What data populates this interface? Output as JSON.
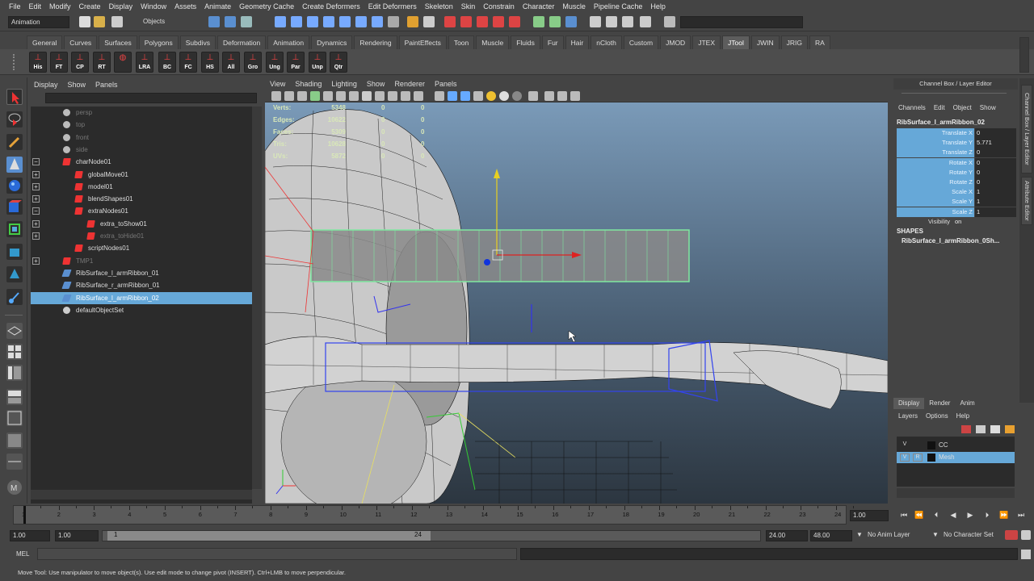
{
  "menubar": [
    "File",
    "Edit",
    "Modify",
    "Create",
    "Display",
    "Window",
    "Assets",
    "Animate",
    "Geometry Cache",
    "Create Deformers",
    "Edit Deformers",
    "Skeleton",
    "Skin",
    "Constrain",
    "Character",
    "Muscle",
    "Pipeline Cache",
    "Help"
  ],
  "status": {
    "mode": "Animation",
    "selection_mode": "Objects"
  },
  "shelf_tabs": [
    "General",
    "Curves",
    "Surfaces",
    "Polygons",
    "Subdivs",
    "Deformation",
    "Animation",
    "Dynamics",
    "Rendering",
    "PaintEffects",
    "Toon",
    "Muscle",
    "Fluids",
    "Fur",
    "Hair",
    "nCloth",
    "Custom",
    "JMOD",
    "JTEX",
    "JTool",
    "JWIN",
    "JRIG",
    "RA"
  ],
  "shelf_active": "JTool",
  "shelf_buttons": [
    "His",
    "FT",
    "CP",
    "RT",
    "",
    "LRA",
    "BC",
    "FC",
    "HS",
    "All",
    "Gro",
    "Ung",
    "Par",
    "Unp",
    "Qtr"
  ],
  "outliner": {
    "menu": [
      "Display",
      "Show",
      "Panels"
    ],
    "rows": [
      {
        "label": "persp",
        "indent": 0,
        "icon": "camera",
        "dim": true,
        "exp": ""
      },
      {
        "label": "top",
        "indent": 0,
        "icon": "camera",
        "dim": true,
        "exp": ""
      },
      {
        "label": "front",
        "indent": 0,
        "icon": "camera",
        "dim": true,
        "exp": ""
      },
      {
        "label": "side",
        "indent": 0,
        "icon": "camera",
        "dim": true,
        "exp": ""
      },
      {
        "label": "charNode01",
        "indent": 0,
        "icon": "transform",
        "dim": false,
        "exp": "−"
      },
      {
        "label": "globalMove01",
        "indent": 1,
        "icon": "transform",
        "dim": false,
        "exp": "+"
      },
      {
        "label": "model01",
        "indent": 1,
        "icon": "transform",
        "dim": false,
        "exp": "+"
      },
      {
        "label": "blendShapes01",
        "indent": 1,
        "icon": "transform",
        "dim": false,
        "exp": "+"
      },
      {
        "label": "extraNodes01",
        "indent": 1,
        "icon": "transform",
        "dim": false,
        "exp": "−"
      },
      {
        "label": "extra_toShow01",
        "indent": 2,
        "icon": "transform",
        "dim": false,
        "exp": "+"
      },
      {
        "label": "extra_toHide01",
        "indent": 2,
        "icon": "transform",
        "dim": true,
        "exp": "+"
      },
      {
        "label": "scriptNodes01",
        "indent": 1,
        "icon": "transform",
        "dim": false,
        "exp": ""
      },
      {
        "label": "TMP1",
        "indent": 0,
        "icon": "transform",
        "dim": true,
        "exp": "+"
      },
      {
        "label": "RibSurface_l_armRibbon_01",
        "indent": 0,
        "icon": "surface",
        "dim": false,
        "exp": ""
      },
      {
        "label": "RibSurface_r_armRibbon_01",
        "indent": 0,
        "icon": "surface",
        "dim": false,
        "exp": ""
      },
      {
        "label": "RibSurface_l_armRibbon_02",
        "indent": 0,
        "icon": "surface",
        "dim": false,
        "exp": "",
        "selected": true
      },
      {
        "label": "defaultObjectSet",
        "indent": 0,
        "icon": "set",
        "dim": false,
        "exp": ""
      }
    ]
  },
  "viewport": {
    "menu": [
      "View",
      "Shading",
      "Lighting",
      "Show",
      "Renderer",
      "Panels"
    ],
    "hud": [
      {
        "label": "Verts:",
        "v1": "5348",
        "v2": "0",
        "v3": "0"
      },
      {
        "label": "Edges:",
        "v1": "10622",
        "v2": "0",
        "v3": "0"
      },
      {
        "label": "Faces:",
        "v1": "5309",
        "v2": "0",
        "v3": "0"
      },
      {
        "label": "Tris:",
        "v1": "10628",
        "v2": "0",
        "v3": "0"
      },
      {
        "label": "UVs:",
        "v1": "5872",
        "v2": "0",
        "v3": "0"
      }
    ]
  },
  "channel_box": {
    "title": "Channel Box / Layer Editor",
    "menu": [
      "Channels",
      "Edit",
      "Object",
      "Show"
    ],
    "object": "RibSurface_l_armRibbon_02",
    "attrs": [
      {
        "name": "Translate X",
        "value": "0"
      },
      {
        "name": "Translate Y",
        "value": "5.771"
      },
      {
        "name": "Translate Z",
        "value": "0"
      },
      {
        "name": "Rotate X",
        "value": "0"
      },
      {
        "name": "Rotate Y",
        "value": "0"
      },
      {
        "name": "Rotate Z",
        "value": "0"
      },
      {
        "name": "Scale X",
        "value": "1"
      },
      {
        "name": "Scale Y",
        "value": "1"
      },
      {
        "name": "Scale Z",
        "value": "1"
      },
      {
        "name": "Visibility",
        "value": "on"
      }
    ],
    "shapes_label": "SHAPES",
    "shape_name": "RibSurface_l_armRibbon_0Sh...",
    "side_tabs": [
      "Channel Box / Layer Editor",
      "Attribute Editor"
    ]
  },
  "layers": {
    "tabs": [
      "Display",
      "Render",
      "Anim"
    ],
    "menu": [
      "Layers",
      "Options",
      "Help"
    ],
    "rows": [
      {
        "v": "V",
        "r": "",
        "name": "CC"
      },
      {
        "v": "V",
        "r": "R",
        "name": "Mesh",
        "selected": true
      }
    ]
  },
  "timeline": {
    "ticks": [
      "1",
      "2",
      "3",
      "4",
      "5",
      "6",
      "7",
      "8",
      "9",
      "10",
      "11",
      "12",
      "13",
      "14",
      "15",
      "16",
      "17",
      "18",
      "19",
      "20",
      "21",
      "22",
      "23",
      "24"
    ],
    "current": "1.00"
  },
  "range": {
    "start": "1.00",
    "playback_start": "1.00",
    "range_in": "1",
    "range_out": "24",
    "playback_end": "24.00",
    "end": "48.00",
    "anim_layer": "No Anim Layer",
    "char_set": "No Character Set"
  },
  "command": {
    "label": "MEL"
  },
  "help": "Move Tool: Use manipulator to move object(s). Use edit mode to change pivot (INSERT). Ctrl+LMB to move perpendicular."
}
